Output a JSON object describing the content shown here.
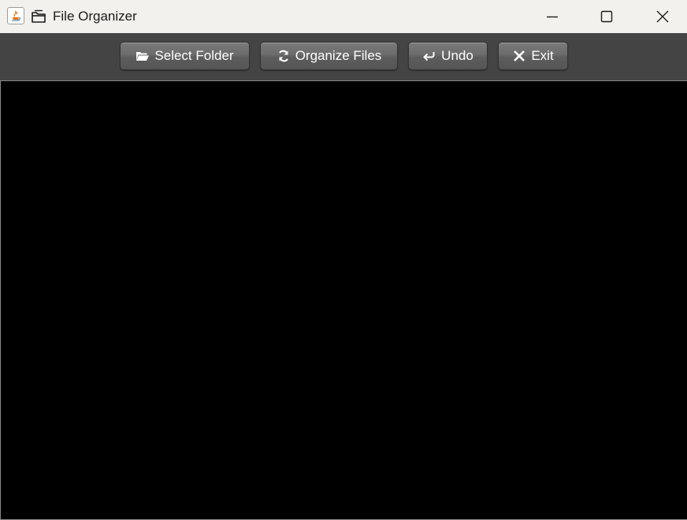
{
  "window": {
    "title": "File Organizer",
    "icons": {
      "app": "java-icon",
      "folder": "folder-icon"
    },
    "controls": {
      "minimize": "minimize-icon",
      "maximize": "maximize-icon",
      "close": "close-icon"
    }
  },
  "toolbar": {
    "buttons": [
      {
        "label": "Select Folder",
        "icon": "open-folder-icon"
      },
      {
        "label": "Organize Files",
        "icon": "refresh-icon"
      },
      {
        "label": "Undo",
        "icon": "undo-arrow-icon"
      },
      {
        "label": "Exit",
        "icon": "x-icon"
      }
    ]
  },
  "content": {
    "background": "#000000"
  },
  "colors": {
    "titlebar": "#f3f1ee",
    "toolbar": "#444444",
    "button_text": "#ffffff"
  }
}
